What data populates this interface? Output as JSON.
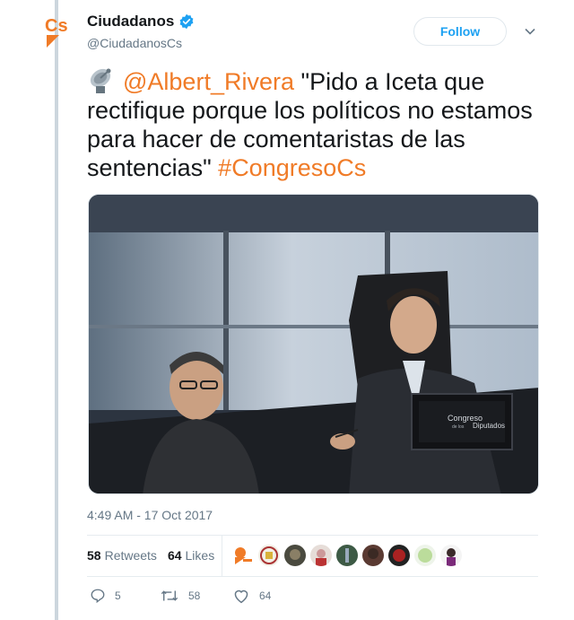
{
  "account": {
    "display_name": "Ciudadanos",
    "handle": "@CiudadanosCs",
    "logo_text": "Cs"
  },
  "follow_label": "Follow",
  "tweet": {
    "mention": "@Albert_Rivera",
    "text": " \"Pido a Iceta que rectifique porque los políticos no estamos para hacer de comentaristas de las sentencias\" ",
    "hashtag": "#CongresoCs"
  },
  "photo": {
    "nameplate_line1": "Congreso",
    "nameplate_line2": "de los",
    "nameplate_line3": "Diputados"
  },
  "timestamp": "4:49 AM - 17 Oct 2017",
  "stats": {
    "retweets_count": "58",
    "retweets_label": "Retweets",
    "likes_count": "64",
    "likes_label": "Likes"
  },
  "actions": {
    "replies": "5",
    "retweets": "58",
    "likes": "64"
  },
  "colors": {
    "brand": "#f07b27",
    "link": "#f07b27",
    "verified": "#1da1f2",
    "muted": "#657786"
  }
}
